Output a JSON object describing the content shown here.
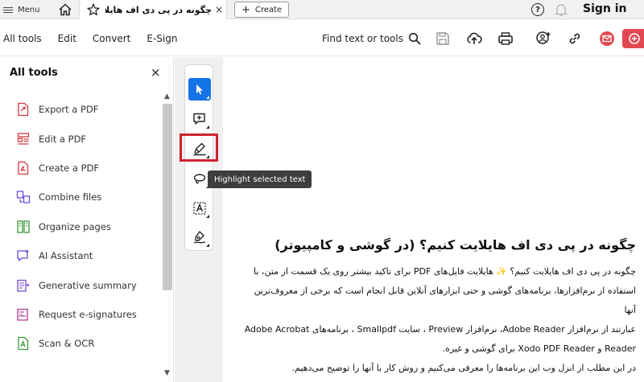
{
  "titlebar": {
    "menu_label": "Menu",
    "tab_title": "چگونه در پی دی اف هایلایت ...",
    "tab_close": "×",
    "create_label": "Create",
    "help_glyph": "?",
    "sign_in": "Sign in"
  },
  "toolbar": {
    "tabs": [
      {
        "label": "All tools"
      },
      {
        "label": "Edit"
      },
      {
        "label": "Convert"
      },
      {
        "label": "E-Sign"
      }
    ],
    "find_label": "Find text or tools"
  },
  "panel": {
    "title": "All tools",
    "close": "×",
    "tools": [
      {
        "label": "Export a PDF",
        "icon": "export-pdf-icon",
        "color": "#d7373f"
      },
      {
        "label": "Edit a PDF",
        "icon": "edit-pdf-icon",
        "color": "#d7373f"
      },
      {
        "label": "Create a PDF",
        "icon": "create-pdf-icon",
        "color": "#d7373f"
      },
      {
        "label": "Combine files",
        "icon": "combine-files-icon",
        "color": "#6e4bd8"
      },
      {
        "label": "Organize pages",
        "icon": "organize-pages-icon",
        "color": "#3a9a3a"
      },
      {
        "label": "AI Assistant",
        "icon": "ai-assistant-icon",
        "color": "#6e4bd8"
      },
      {
        "label": "Generative summary",
        "icon": "generative-summary-icon",
        "color": "#6e4bd8"
      },
      {
        "label": "Request e-signatures",
        "icon": "request-esignatures-icon",
        "color": "#b0378f"
      },
      {
        "label": "Scan & OCR",
        "icon": "scan-ocr-icon",
        "color": "#3a9a3a"
      }
    ]
  },
  "quick_tools": {
    "tooltip": "Highlight selected text"
  },
  "document": {
    "heading": "چگونه در پی دی اف هایلایت کنیم؟ (در گوشی و کامپیوتر)",
    "lines": [
      "چگونه در پی دی اف هایلایت کنیم؟ ✨ هایلایت فایل‌های PDF برای تاکید بیشتر روی یک قسمت از متن، با",
      "استفاده از نرم‌افزارها، برنامه‌های گوشی و حتی ابزارهای آنلاین قابل انجام است که برخی از معروف‌ترین آنها",
      "عبارتند از نرم‌افزار Adobe Reader، نرم‌افزار Preview ، سایت Smallpdf ، برنامه‌های Adobe Acrobat",
      "Reader و Xodo PDF Reader برای گوشی و غیره.",
      "در این مطلب از انزل وب این برنامه‌ها را معرفی می‌کنیم و روش کار با آنها را توضیح می‌دهیم."
    ]
  },
  "colors": {
    "accent": "#1473e6",
    "highlight_box": "#d0232f",
    "share": "#e34850"
  }
}
